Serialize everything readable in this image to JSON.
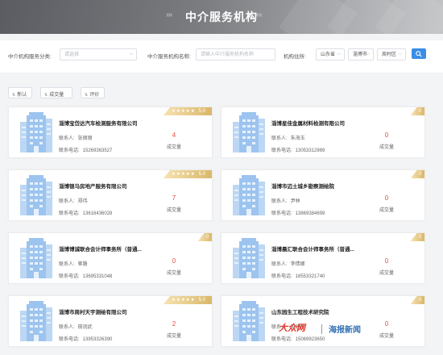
{
  "header": {
    "title": "中介服务机构",
    "arrows_left": "›››",
    "arrows_right": "‹‹‹"
  },
  "filters": {
    "category_label": "中介机构服务分类:",
    "category_placeholder": "请选择",
    "name_label": "中介服务机构名称:",
    "name_placeholder": "请输入中介服务机构名称",
    "location_label": "机构住所:",
    "province_value": "山东省",
    "city_value": "淄博市",
    "district_value": "周村区"
  },
  "toolbar": {
    "new_label": "新认",
    "deals_label": "成交量",
    "rating_label": "评价"
  },
  "labels": {
    "contact": "联系人:",
    "phone": "联系电话:",
    "deals": "成交量"
  },
  "accent_color": "#3a8ee6",
  "highlight_color": "#e84d3d",
  "cards": [
    {
      "name": "淄博宝岱达汽车检测服务有限公司",
      "contact": "张丽丽",
      "phone": "15269363527",
      "deals": "4",
      "stars": "★★★★★",
      "rating": "5.0"
    },
    {
      "name": "淄博星佳金属材料检测有限公司",
      "contact": "朱海玉",
      "phone": "13053312869",
      "deals": "0",
      "stars": "",
      "rating": "0"
    },
    {
      "name": "淄博银马房地产服务有限公司",
      "contact": "郑伟",
      "phone": "13616436028",
      "deals": "7",
      "stars": "★★★★★",
      "rating": "5.0"
    },
    {
      "name": "淄博市迈土城乡勘察测绘院",
      "contact": "尹林",
      "phone": "13869384699",
      "deals": "0",
      "stars": "",
      "rating": "0"
    },
    {
      "name": "淄博博诚联合会计师事务所（普通...",
      "contact": "崔路",
      "phone": "13695331048",
      "deals": "0",
      "stars": "",
      "rating": "0"
    },
    {
      "name": "淄博晨汇联合会计师事务所（普通...",
      "contact": "李倩娜",
      "phone": "18553321740",
      "deals": "0",
      "stars": "",
      "rating": "0"
    },
    {
      "name": "淄博市周村天宇测绘有限公司",
      "contact": "田润武",
      "phone": "13953326390",
      "deals": "2",
      "stars": "★★★★★",
      "rating": "5.0"
    },
    {
      "name": "山东园生工程技术研究院",
      "contact": "王建华",
      "phone": "15069923650",
      "deals": "0",
      "stars": "",
      "rating": "0"
    }
  ],
  "watermark": {
    "left": "大众网",
    "right": "海报新闻"
  }
}
